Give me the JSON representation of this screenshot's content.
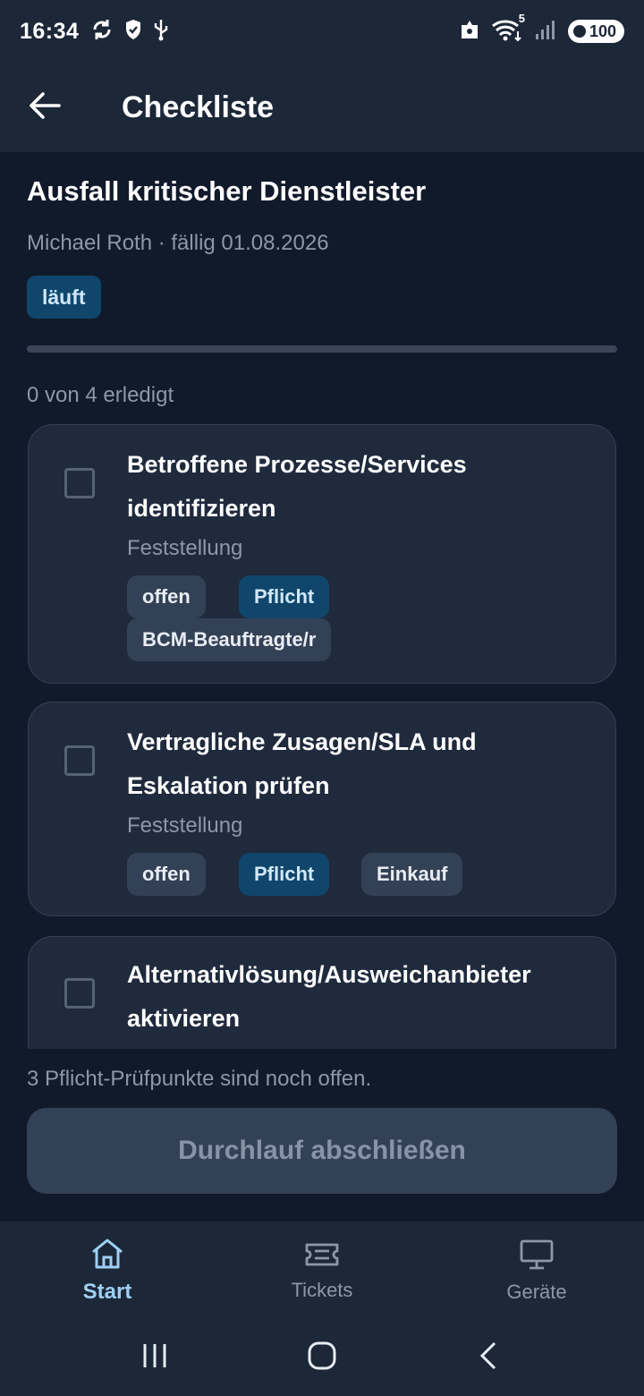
{
  "status_bar": {
    "time": "16:34",
    "battery": "100",
    "wifi_label": "5"
  },
  "app_bar": {
    "title": "Checkliste"
  },
  "run": {
    "title": "Ausfall kritischer Dienstleister",
    "meta": "Michael Roth · fällig 01.08.2026",
    "status": "läuft",
    "progress_fraction": 0,
    "progress_text": "0 von 4 erledigt"
  },
  "items": [
    {
      "title": "Betroffene Prozesse/Services identifizieren",
      "category": "Feststellung",
      "tags": [
        "offen",
        "Pflicht",
        "BCM-Beauftragte/r"
      ],
      "checked": false
    },
    {
      "title": "Vertragliche Zusagen/SLA und Eskalation prüfen",
      "category": "Feststellung",
      "tags": [
        "offen",
        "Pflicht",
        "Einkauf"
      ],
      "checked": false
    },
    {
      "title": "Alternativlösung/Ausweichanbieter aktivieren",
      "checked": false
    }
  ],
  "footer": {
    "hint": "3 Pflicht-Prüfpunkte sind noch offen.",
    "finish_label": "Durchlauf abschließen"
  },
  "bottom_nav": {
    "items": [
      {
        "label": "Start",
        "icon": "home-icon",
        "active": true
      },
      {
        "label": "Tickets",
        "icon": "ticket-icon",
        "active": false
      },
      {
        "label": "Geräte",
        "icon": "monitor-icon",
        "active": false
      }
    ]
  },
  "colors": {
    "background": "#111a2b",
    "surface": "#1c2738",
    "card": "#1f2a3d",
    "accent": "#10466b",
    "accent_text": "#cfe8fb",
    "active_nav": "#9fd0f4"
  }
}
